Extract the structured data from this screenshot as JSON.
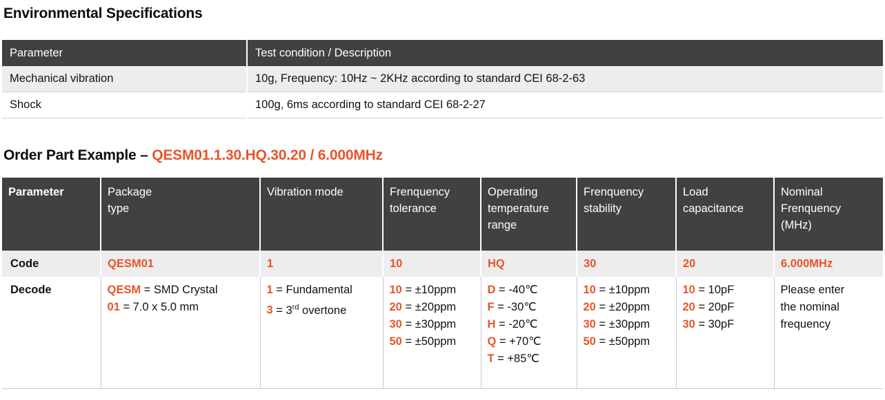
{
  "environmental": {
    "heading": "Environmental Specifications",
    "columns": [
      "Parameter",
      "Test condition / Description"
    ],
    "rows": [
      {
        "parameter": "Mechanical vibration",
        "description": "10g, Frequency: 10Hz ~ 2KHz according to standard CEI 68-2-63"
      },
      {
        "parameter": "Shock",
        "description": "100g, 6ms according to standard CEI 68-2-27"
      }
    ]
  },
  "order_part": {
    "heading_prefix": "Order Part Example – ",
    "heading_part_number": "QESM01.1.30.HQ.30.20 / 6.000MHz",
    "accent_color": "#E8542A",
    "header_color": "#414141",
    "alt_row_color": "#ededed",
    "columns": [
      "Parameter",
      "Package\ntype",
      "Vibration mode",
      "Frenquency\ntolerance",
      "Operating\ntemperature\nrange",
      "Frenquency\nstability",
      "Load\ncapacitance",
      "Nominal\nFrenquency\n(MHz)"
    ],
    "columns_display": {
      "parameter": "Parameter",
      "package_type": "Package<br>type",
      "vibration_mode": "Vibration mode",
      "frequency_tolerance": "Frenquency<br>tolerance",
      "operating_temperature_range": "Operating<br>temperature<br>range",
      "frequency_stability": "Frenquency<br>stability",
      "load_capacitance": "Load<br>capacitance",
      "nominal_frequency": "Nominal<br>Frenquency<br>(MHz)"
    },
    "code_row": {
      "label": "Code",
      "package_type": "QESM01",
      "vibration_mode": "1",
      "frequency_tolerance": "10",
      "operating_temperature_range": "HQ",
      "frequency_stability": "30",
      "load_capacitance": "20",
      "nominal_frequency": "6.000MHz"
    },
    "decode_row": {
      "label": "Decode",
      "package_type": [
        {
          "key": "QESM",
          "value": " = SMD Crystal"
        },
        {
          "key": "01",
          "value": " = 7.0 x 5.0 mm"
        }
      ],
      "vibration_mode": [
        {
          "key": "1",
          "value": " = Fundamental"
        },
        {
          "key": "3",
          "value": " = 3rd overtone",
          "value_html": " = 3<sup class=\"sup\">rd</sup> overtone"
        }
      ],
      "frequency_tolerance": [
        {
          "key": "10",
          "value": " = ±10ppm"
        },
        {
          "key": "20",
          "value": " = ±20ppm"
        },
        {
          "key": "30",
          "value": " = ±30ppm"
        },
        {
          "key": "50",
          "value": " = ±50ppm"
        }
      ],
      "operating_temperature_range": [
        {
          "key": "D",
          "value": " = -40℃"
        },
        {
          "key": "F",
          "value": " =  -30℃"
        },
        {
          "key": "H",
          "value": " = -20℃"
        },
        {
          "key": "Q",
          "value": " = +70℃"
        },
        {
          "key": "T",
          "value": " = +85℃"
        }
      ],
      "frequency_stability": [
        {
          "key": "10",
          "value": " = ±10ppm"
        },
        {
          "key": "20",
          "value": " = ±20ppm"
        },
        {
          "key": "30",
          "value": " = ±30ppm"
        },
        {
          "key": "50",
          "value": " = ±50ppm"
        }
      ],
      "load_capacitance": [
        {
          "key": "10",
          "value": " = 10pF"
        },
        {
          "key": "20",
          "value": " = 20pF"
        },
        {
          "key": "30",
          "value": " = 30pF"
        }
      ],
      "nominal_frequency_note": [
        "Please enter",
        "the nominal",
        "frequency"
      ]
    }
  }
}
